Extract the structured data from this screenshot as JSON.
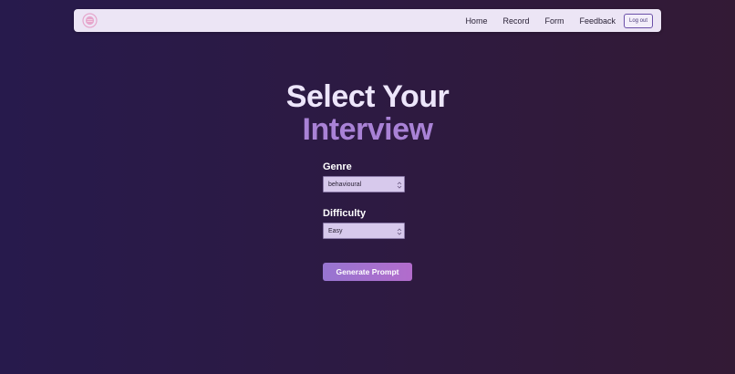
{
  "nav": {
    "logo_icon": "circle-logo-icon",
    "links": [
      "Home",
      "Record",
      "Form",
      "Feedback"
    ],
    "logout_label": "Log out"
  },
  "hero": {
    "title_line1": "Select Your",
    "title_line2": "Interview"
  },
  "form": {
    "genre_label": "Genre",
    "genre_value": "behavioural",
    "difficulty_label": "Difficulty",
    "difficulty_value": "Easy",
    "generate_label": "Generate Prompt"
  },
  "colors": {
    "accent": "#a982d6",
    "button_gradient_start": "#9775d0",
    "button_gradient_end": "#b26ccc",
    "navbar_bg": "#ece5f5"
  }
}
